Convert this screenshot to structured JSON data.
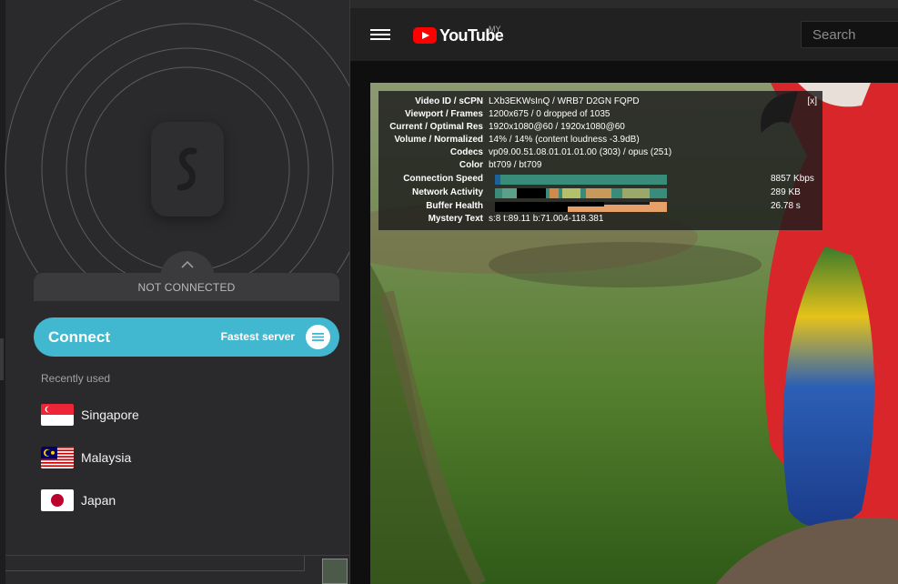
{
  "vpn": {
    "status": "NOT CONNECTED",
    "connect_label": "Connect",
    "fastest_label": "Fastest server",
    "recent_heading": "Recently used",
    "locations": [
      {
        "name": "Singapore",
        "flag": "singapore-flag"
      },
      {
        "name": "Malaysia",
        "flag": "malaysia-flag"
      },
      {
        "name": "Japan",
        "flag": "japan-flag"
      }
    ],
    "accent": "#41b8d0"
  },
  "youtube": {
    "wordmark": "YouTube",
    "country": "MY",
    "search_placeholder": "Search",
    "brand_color": "#ff0000"
  },
  "stats": {
    "close": "[x]",
    "rows": [
      {
        "label": "Video ID / sCPN",
        "value": "LXb3EKWsInQ / WRB7 D2GN FQPD"
      },
      {
        "label": "Viewport / Frames",
        "value": "1200x675 / 0 dropped of 1035"
      },
      {
        "label": "Current / Optimal Res",
        "value": "1920x1080@60 / 1920x1080@60"
      },
      {
        "label": "Volume / Normalized",
        "value": "14% / 14% (content loudness -3.9dB)"
      },
      {
        "label": "Codecs",
        "value": "vp09.00.51.08.01.01.01.00 (303) / opus (251)"
      },
      {
        "label": "Color",
        "value": "bt709 / bt709"
      }
    ],
    "graphs": [
      {
        "label": "Connection Speed",
        "value": "8857 Kbps"
      },
      {
        "label": "Network Activity",
        "value": "289 KB"
      },
      {
        "label": "Buffer Health",
        "value": "26.78 s"
      }
    ],
    "mystery": {
      "label": "Mystery Text",
      "value": "s:8 t:89.11 b:71.004-118.381"
    }
  }
}
